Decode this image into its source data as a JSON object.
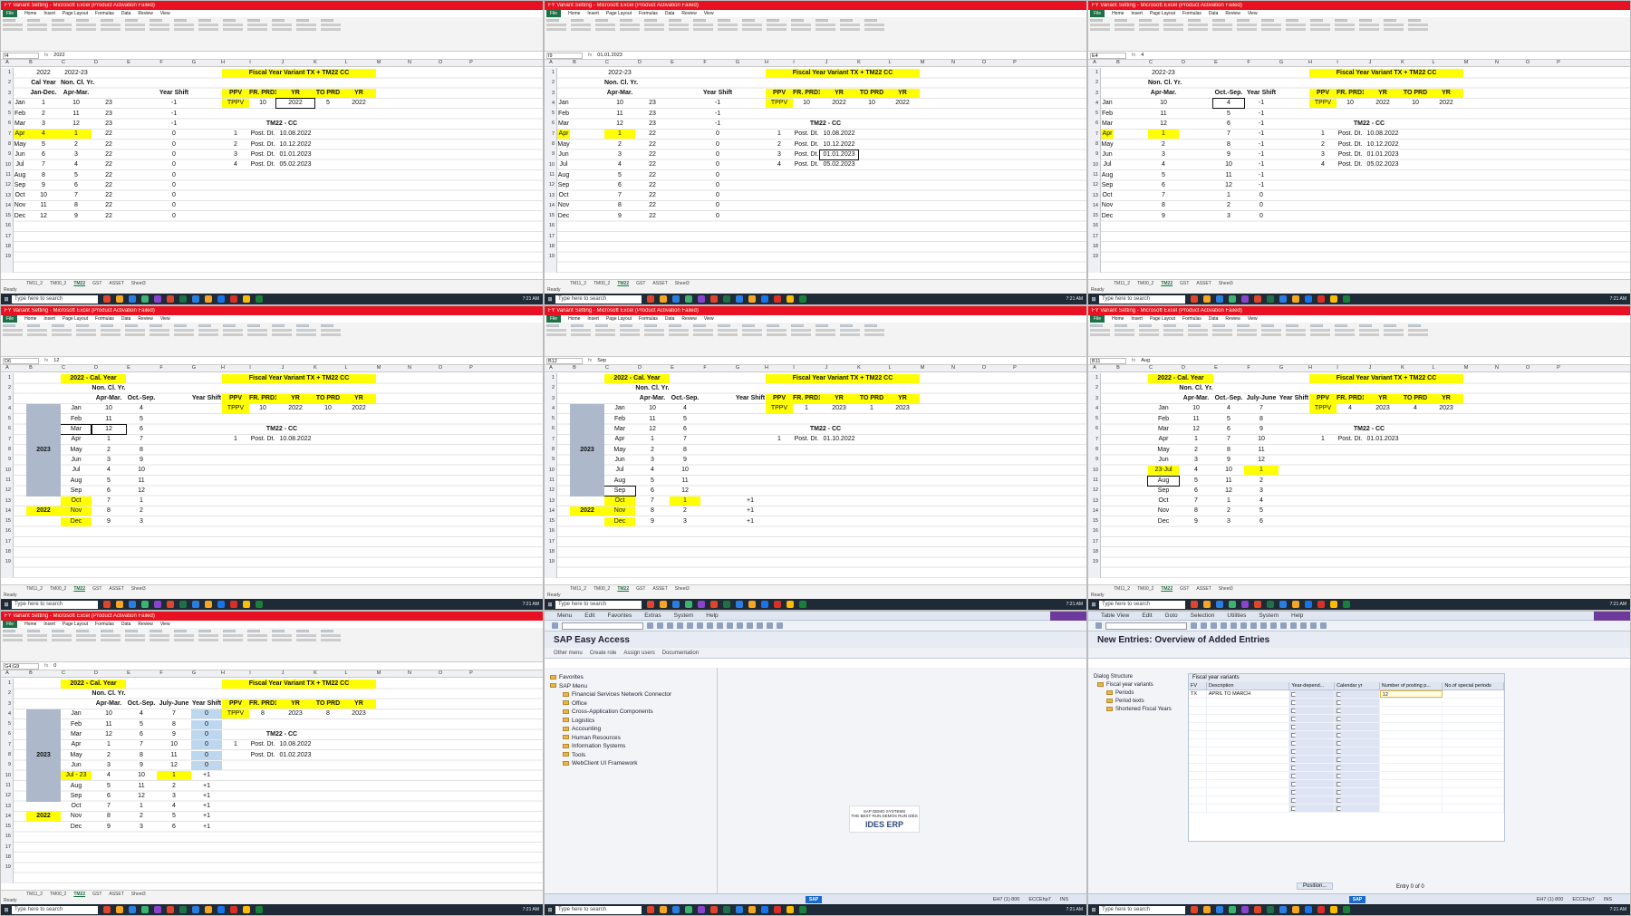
{
  "excel": {
    "title_bar": "FY Variant Setting - Microsoft Excel (Product Activation Failed)",
    "menu": [
      "File",
      "Home",
      "Insert",
      "Page Layout",
      "Formulas",
      "Data",
      "Review",
      "View"
    ],
    "sheet_tabs": [
      "TM11_2",
      "TM00_2",
      "TM22",
      "GST",
      "ASSET",
      "Sheet3"
    ],
    "active_sheet": "TM22",
    "status": "Ready",
    "col_letters": [
      "A",
      "B",
      "C",
      "D",
      "E",
      "F",
      "G",
      "H",
      "I",
      "J",
      "K",
      "L",
      "M",
      "N",
      "O",
      "P"
    ],
    "rows": [
      "1",
      "2",
      "3",
      "4",
      "5",
      "6",
      "7",
      "8",
      "9",
      "10",
      "11",
      "12",
      "13",
      "14",
      "15",
      "16",
      "17",
      "18",
      "19"
    ],
    "months": [
      "Jan",
      "Feb",
      "Mar",
      "Apr",
      "May",
      "Jun",
      "Jul",
      "Aug",
      "Sep",
      "Oct",
      "Nov",
      "Dec"
    ],
    "panes": [
      {
        "name_box": "I4",
        "formula": "2022",
        "hdr": {
          "b1": "2022",
          "c1": "2022-23",
          "b2": "Cal Year",
          "c2": "Non. Cl. Yr.",
          "b3": "Jan-Dec.",
          "c3": "Apr-Mar.",
          "f3": "Year Shift"
        },
        "cal": [
          "1",
          "2",
          "3",
          "4",
          "5",
          "6",
          "7",
          "8",
          "9",
          "10",
          "11",
          "12"
        ],
        "ncy": [
          "10",
          "11",
          "12",
          "1",
          "2",
          "3",
          "4",
          "5",
          "6",
          "7",
          "8",
          "9"
        ],
        "d": [
          "23",
          "23",
          "23",
          "22",
          "22",
          "22",
          "22",
          "22",
          "22",
          "22",
          "22",
          "22"
        ],
        "shift": [
          "-1",
          "-1",
          "-1",
          "0",
          "0",
          "0",
          "0",
          "0",
          "0",
          "0",
          "0",
          "0"
        ],
        "fyv": {
          "title": "Fiscal Year Variant TX + TM22 CC",
          "h": [
            "PPV",
            "FR. PRD1",
            "YR",
            "TO PRD",
            "YR"
          ],
          "v": [
            "TPPV",
            "10",
            "2022",
            "5",
            "2022"
          ]
        },
        "cc": {
          "title": "TM22 - CC",
          "rows": [
            [
              "1",
              "Post. Dt.",
              "10.08.2022"
            ],
            [
              "2",
              "Post. Dt.",
              "10.12.2022"
            ],
            [
              "3",
              "Post. Dt.",
              "01.01.2023"
            ],
            [
              "4",
              "Post. Dt.",
              "05.02.2023"
            ]
          ]
        }
      },
      {
        "name_box": "I9",
        "formula": "01.01.2023",
        "hdr": {
          "c1": "2022-23",
          "c2": "Non. Cl. Yr.",
          "c3": "Apr-Mar.",
          "f3": "Year Shift"
        },
        "ncy": [
          "10",
          "11",
          "12",
          "1",
          "2",
          "3",
          "4",
          "5",
          "6",
          "7",
          "8",
          "9"
        ],
        "d": [
          "23",
          "23",
          "23",
          "22",
          "22",
          "22",
          "22",
          "22",
          "22",
          "22",
          "22",
          "22"
        ],
        "shift": [
          "-1",
          "-1",
          "-1",
          "0",
          "0",
          "0",
          "0",
          "0",
          "0",
          "0",
          "0",
          "0"
        ],
        "fyv": {
          "title": "Fiscal Year Variant TX + TM22 CC",
          "h": [
            "PPV",
            "FR. PRD1",
            "YR",
            "TO PRD",
            "YR"
          ],
          "v": [
            "TPPV",
            "10",
            "2022",
            "10",
            "2022"
          ]
        },
        "cc": {
          "title": "TM22 - CC",
          "rows": [
            [
              "1",
              "Post. Dt.",
              "10.08.2022"
            ],
            [
              "2",
              "Post. Dt.",
              "10.12.2022"
            ],
            [
              "3",
              "Post. Dt.",
              "01.01.2023"
            ],
            [
              "4",
              "Post. Dt.",
              "05.02.2023"
            ]
          ]
        }
      },
      {
        "name_box": "E4",
        "formula": "4",
        "hdr": {
          "c1": "2022-23",
          "c2": "Non. Cl. Yr.",
          "c3": "Apr-Mar.",
          "e3": "Oct.-Sep.",
          "f3": "Year Shift"
        },
        "ncy": [
          "10",
          "11",
          "12",
          "1",
          "2",
          "3",
          "4",
          "5",
          "6",
          "7",
          "8",
          "9"
        ],
        "oct": [
          "4",
          "5",
          "6",
          "7",
          "8",
          "9",
          "10",
          "11",
          "12",
          "1",
          "2",
          "3"
        ],
        "shift": [
          "-1",
          "-1",
          "-1",
          "-1",
          "-1",
          "-1",
          "-1",
          "-1",
          "-1",
          "0",
          "0",
          "0"
        ],
        "fyv": {
          "title": "Fiscal Year Variant TX + TM22 CC",
          "h": [
            "PPV",
            "FR. PRD1",
            "YR",
            "TO PRD",
            "YR"
          ],
          "v": [
            "TPPV",
            "10",
            "2022",
            "10",
            "2022"
          ]
        },
        "cc": {
          "title": "TM22 - CC",
          "rows": [
            [
              "1",
              "Post. Dt.",
              "10.08.2022"
            ],
            [
              "2",
              "Post. Dt.",
              "10.12.2022"
            ],
            [
              "3",
              "Post. Dt.",
              "01.01.2023"
            ],
            [
              "4",
              "Post. Dt.",
              "05.02.2023"
            ]
          ]
        }
      },
      {
        "name_box": "D6",
        "formula": "12",
        "hdr": {
          "t1": "2022 - Cal. Year",
          "c2": "Non. Cl. Yr.",
          "c3": "Apr-Mar.",
          "e3": "Oct.-Sep.",
          "f3": "Year Shift"
        },
        "mon": [
          "Jan",
          "Feb",
          "Mar",
          "Apr",
          "May",
          "Jun",
          "Jul",
          "Aug",
          "Sep",
          "Oct",
          "Nov",
          "Dec"
        ],
        "ncy": [
          "10",
          "11",
          "12",
          "1",
          "2",
          "3",
          "4",
          "5",
          "6",
          "7",
          "8",
          "9"
        ],
        "oct": [
          "4",
          "5",
          "6",
          "7",
          "8",
          "9",
          "10",
          "11",
          "12",
          "1",
          "2",
          "3"
        ],
        "years": [
          "2023",
          "2022"
        ],
        "fyv": {
          "title": "Fiscal Year Variant TX + TM22 CC",
          "h": [
            "PPV",
            "FR. PRD1",
            "YR",
            "TO PRD",
            "YR"
          ],
          "v": [
            "TPPV",
            "10",
            "2022",
            "10",
            "2022"
          ]
        },
        "cc": {
          "title": "TM22 - CC",
          "rows": [
            [
              "1",
              "Post. Dt.",
              "10.08.2022"
            ]
          ]
        }
      },
      {
        "name_box": "B12",
        "formula": "Sep",
        "hdr": {
          "t1": "2022 - Cal. Year",
          "c2": "Non. Cl. Yr.",
          "c3": "Apr-Mar.",
          "e3": "Oct.-Sep.",
          "f3": "Year Shift"
        },
        "mon": [
          "Jan",
          "Feb",
          "Mar",
          "Apr",
          "May",
          "Jun",
          "Jul",
          "Aug",
          "Sep",
          "Oct",
          "Nov",
          "Dec"
        ],
        "ncy": [
          "10",
          "11",
          "12",
          "1",
          "2",
          "3",
          "4",
          "5",
          "6",
          "7",
          "8",
          "9"
        ],
        "oct": [
          "4",
          "5",
          "6",
          "7",
          "8",
          "9",
          "10",
          "11",
          "12",
          "1",
          "2",
          "3"
        ],
        "shift": [
          "",
          "",
          "",
          "",
          "",
          "",
          "",
          "",
          "",
          "+1",
          "+1",
          "+1"
        ],
        "years": [
          "2023",
          "2022"
        ],
        "fyv": {
          "title": "Fiscal Year Variant TX + TM22 CC",
          "h": [
            "PPV",
            "FR. PRD1",
            "YR",
            "TO PRD",
            "YR"
          ],
          "v": [
            "TPPV",
            "1",
            "2023",
            "1",
            "2023"
          ]
        },
        "cc": {
          "title": "TM22 - CC",
          "rows": [
            [
              "1",
              "Post. Dt.",
              "01.10.2022"
            ]
          ]
        }
      },
      {
        "name_box": "B11",
        "formula": "Aug",
        "hdr": {
          "t1": "2022 - Cal. Year",
          "c2": "Non. Cl. Yr.",
          "c3": "Apr-Mar.",
          "e3": "Oct.-Sep.",
          "g3": "July-June",
          "f3": "Year Shift"
        },
        "mon": [
          "Jan",
          "Feb",
          "Mar",
          "Apr",
          "May",
          "Jun",
          "23-Jul",
          "Aug",
          "Sep",
          "Oct",
          "Nov",
          "Dec"
        ],
        "ncy": [
          "10",
          "11",
          "12",
          "1",
          "2",
          "3",
          "4",
          "5",
          "6",
          "7",
          "8",
          "9"
        ],
        "oct": [
          "4",
          "5",
          "6",
          "7",
          "8",
          "9",
          "10",
          "11",
          "12",
          "1",
          "2",
          "3"
        ],
        "jul": [
          "7",
          "8",
          "9",
          "10",
          "11",
          "12",
          "1",
          "2",
          "3",
          "4",
          "5",
          "6"
        ],
        "fyv": {
          "title": "Fiscal Year Variant TX + TM22 CC",
          "h": [
            "PPV",
            "FR. PRD1",
            "YR",
            "TO PRD",
            "YR"
          ],
          "v": [
            "TPPV",
            "4",
            "2023",
            "4",
            "2023"
          ]
        },
        "cc": {
          "title": "TM22 - CC",
          "rows": [
            [
              "1",
              "Post. Dt.",
              "01.01.2023"
            ]
          ]
        }
      },
      {
        "name_box": "G4:G9",
        "formula": "0",
        "hdr": {
          "t1": "2022 - Cal. Year",
          "c2": "Non. Cl. Yr.",
          "c3": "Apr-Mar.",
          "e3": "Oct.-Sep.",
          "g3": "July-June",
          "f3": "Year Shift"
        },
        "mon": [
          "Jan",
          "Feb",
          "Mar",
          "Apr",
          "May",
          "Jun",
          "Jul - 23",
          "Aug",
          "Sep",
          "Oct",
          "Nov",
          "Dec"
        ],
        "ncy": [
          "10",
          "11",
          "12",
          "1",
          "2",
          "3",
          "4",
          "5",
          "6",
          "7",
          "8",
          "9"
        ],
        "oct": [
          "4",
          "5",
          "6",
          "7",
          "8",
          "9",
          "10",
          "11",
          "12",
          "1",
          "2",
          "3"
        ],
        "jul": [
          "7",
          "8",
          "9",
          "10",
          "11",
          "12",
          "1",
          "2",
          "3",
          "4",
          "5",
          "6"
        ],
        "shift": [
          "0",
          "0",
          "0",
          "0",
          "0",
          "0",
          "+1",
          "+1",
          "+1",
          "+1",
          "+1",
          "+1"
        ],
        "years": [
          "2023",
          "2022"
        ],
        "fyv": {
          "title": "Fiscal Year Variant TX + TM22 CC",
          "h": [
            "PPV",
            "FR. PRD1",
            "YR",
            "TO PRD",
            "YR"
          ],
          "v": [
            "TPPV",
            "8",
            "2023",
            "8",
            "2023"
          ]
        },
        "cc": {
          "title": "TM22 - CC",
          "rows": [
            [
              "1",
              "Post. Dt.",
              "10.08.2022"
            ],
            [
              "",
              "Post. Dt.",
              "01.02.2023"
            ]
          ]
        }
      }
    ]
  },
  "taskbar": {
    "search": "Type here to search",
    "temp": "23°C",
    "time": "7:21 AM",
    "date": "8/10/2022"
  },
  "sap_easy": {
    "menu": [
      "Menu",
      "Edit",
      "Favorites",
      "Extras",
      "System",
      "Help"
    ],
    "title": "SAP Easy Access",
    "app_buttons": [
      "Other menu",
      "Create role",
      "Assign users",
      "Documentation"
    ],
    "tree": [
      {
        "label": "Favorites",
        "lvl": 0
      },
      {
        "label": "SAP Menu",
        "lvl": 0
      },
      {
        "label": "Financial Services Network Connector",
        "lvl": 1
      },
      {
        "label": "Office",
        "lvl": 1
      },
      {
        "label": "Cross-Application Components",
        "lvl": 1
      },
      {
        "label": "Logistics",
        "lvl": 1
      },
      {
        "label": "Accounting",
        "lvl": 1
      },
      {
        "label": "Human Resources",
        "lvl": 1
      },
      {
        "label": "Information Systems",
        "lvl": 1
      },
      {
        "label": "Tools",
        "lvl": 1
      },
      {
        "label": "WebClient UI Framework",
        "lvl": 1
      }
    ],
    "logo_top": "SAP DEMO SYSTEMS",
    "logo_sub": "THE BEST RUN DEMOS RUN IDES",
    "logo_ides": "IDES ERP",
    "status": [
      "EH7 (1) 800",
      "ECCEhp7",
      "INS"
    ]
  },
  "sap_new": {
    "menu": [
      "Table View",
      "Edit",
      "Goto",
      "Selection",
      "Utilities",
      "System",
      "Help"
    ],
    "title": "New Entries: Overview of Added Entries",
    "dialog_title": "Dialog Structure",
    "dialog": [
      {
        "label": "Fiscal year variants",
        "lvl": 0
      },
      {
        "label": "Periods",
        "lvl": 1
      },
      {
        "label": "Period texts",
        "lvl": 1
      },
      {
        "label": "Shortened Fiscal Years",
        "lvl": 1
      }
    ],
    "table_caption": "Fiscal year variants",
    "cols": [
      "FV",
      "Description",
      "Year-depend...",
      "Calendar yr",
      "Number of posting p...",
      "No.of special periods"
    ],
    "row": {
      "fv": "TX",
      "desc": "APRIL TO MARCH",
      "posting": "12"
    },
    "position_btn": "Position...",
    "entry": "Entry 0 of 0",
    "status": [
      "EH7 (1) 800",
      "ECCEhp7",
      "INS"
    ]
  }
}
